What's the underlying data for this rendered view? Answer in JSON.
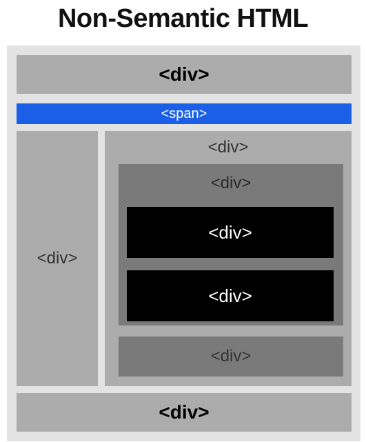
{
  "title": "Non-Semantic HTML",
  "blocks": {
    "header": "<div>",
    "span_bar": "<span>",
    "sidebar": "<div>",
    "main": "<div>",
    "inner": "<div>",
    "black_top": "<div>",
    "black_bottom": "<div>",
    "inner_bottom": "<div>",
    "footer": "<div>"
  },
  "colors": {
    "frame": "#e3e3e3",
    "light_gray": "#acacac",
    "dark_gray": "#7a7a7a",
    "black": "#000000",
    "span_blue": "#1a5fe6"
  }
}
